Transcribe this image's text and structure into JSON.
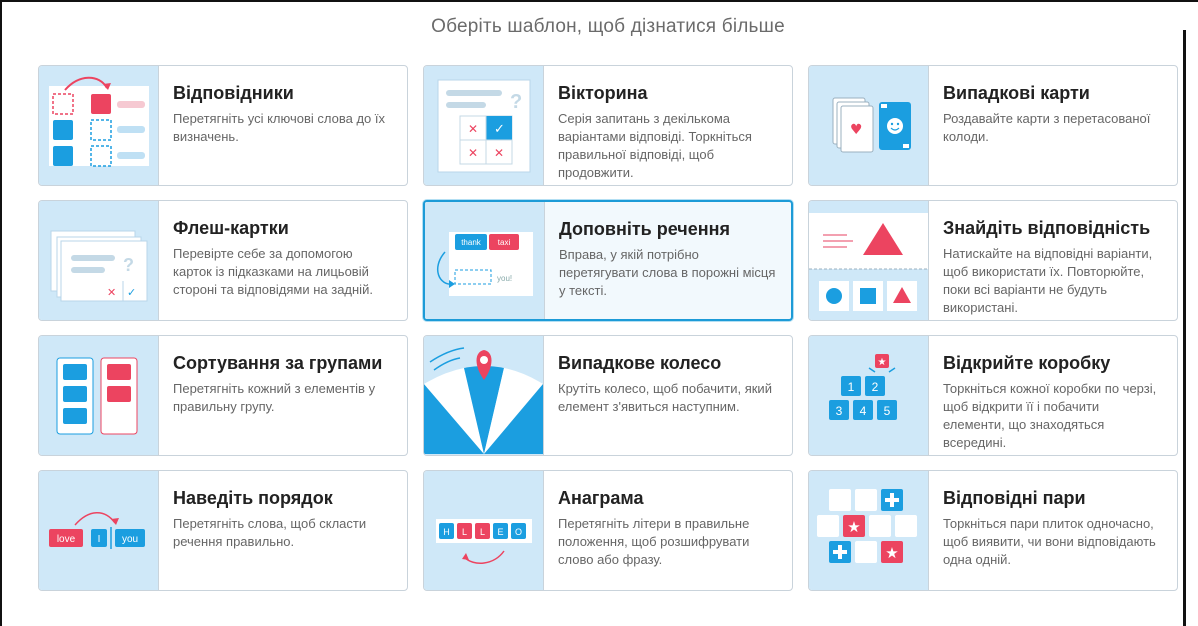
{
  "header": {
    "title": "Оберіть шаблон, щоб дізнатися більше"
  },
  "colors": {
    "accent": "#1d9bd7",
    "thumb_bg": "#cfe8f8",
    "red": "#ec4460",
    "blue": "#1b9ee0"
  },
  "templates": [
    {
      "title": "Відповідники",
      "desc": "Перетягніть усі ключові слова до їх визначень.",
      "icon": "match-up-icon"
    },
    {
      "title": "Вікторина",
      "desc": "Серія запитань з декількома варіантами відповіді. Торкніться правильної відповіді, щоб продовжити.",
      "icon": "quiz-icon"
    },
    {
      "title": "Випадкові карти",
      "desc": "Роздавайте карти з перетасованої колоди.",
      "icon": "random-cards-icon"
    },
    {
      "title": "Флеш-картки",
      "desc": "Перевірте себе за допомогою карток із підказками на лицьовій стороні та відповідями на задній.",
      "icon": "flash-cards-icon"
    },
    {
      "title": "Доповніть речення",
      "desc": "Вправа, у якій потрібно перетягувати слова в порожні місця у тексті.",
      "icon": "complete-sentence-icon",
      "thumb_words": [
        "thank",
        "taxi",
        "you!"
      ]
    },
    {
      "title": "Знайдіть відповідність",
      "desc": "Натискайте на відповідні варіанти, щоб використати їх. Повторюйте, поки всі варіанти не будуть використані.",
      "icon": "find-match-icon"
    },
    {
      "title": "Сортування за групами",
      "desc": "Перетягніть кожний з елементів у правильну групу.",
      "icon": "group-sort-icon"
    },
    {
      "title": "Випадкове колесо",
      "desc": "Крутіть колесо, щоб побачити, який елемент з'явиться наступним.",
      "icon": "spin-wheel-icon"
    },
    {
      "title": "Відкрийте коробку",
      "desc": "Торкніться кожної коробки по черзі, щоб відкрити її і побачити елементи, що знаходяться всередині.",
      "icon": "open-box-icon",
      "thumb_numbers": [
        "1",
        "2",
        "3",
        "4",
        "5"
      ]
    },
    {
      "title": "Наведіть порядок",
      "desc": "Перетягніть слова, щоб скласти речення правильно.",
      "icon": "unjumble-icon",
      "thumb_words": [
        "love",
        "I",
        "you"
      ]
    },
    {
      "title": "Анаграма",
      "desc": "Перетягніть літери в правильне положення, щоб розшифрувати слово або фразу.",
      "icon": "anagram-icon",
      "thumb_letters": [
        "H",
        "L",
        "L",
        "E",
        "O"
      ]
    },
    {
      "title": "Відповідні пари",
      "desc": "Торкніться пари плиток одночасно, щоб виявити, чи вони відповідають одна одній.",
      "icon": "matching-pairs-icon"
    }
  ]
}
